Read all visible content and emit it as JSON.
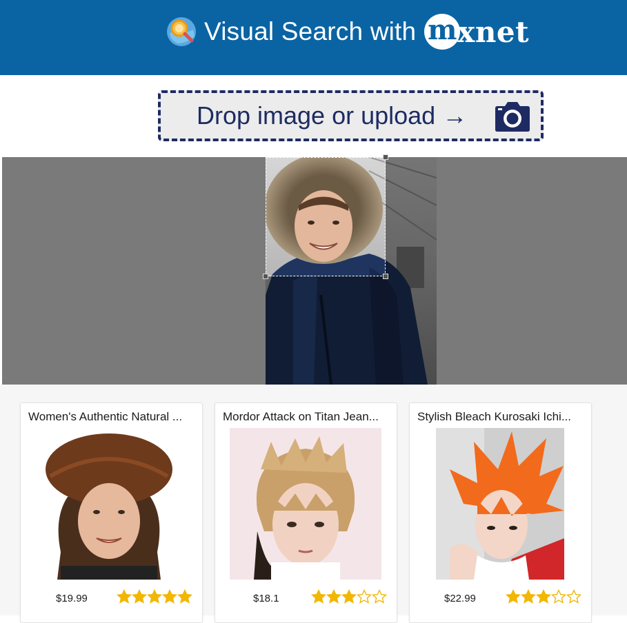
{
  "header": {
    "title": "Visual Search with",
    "brand_initial": "m",
    "brand_rest": "xnet",
    "icon": "magnifier-globe-icon",
    "bg_color": "#0a64a4"
  },
  "upload": {
    "label": "Drop image or upload →",
    "icon": "camera-icon",
    "accent": "#1e2b63"
  },
  "viewer": {
    "image": "query-photo-man-in-fur-hood-parka",
    "crop": "selection-box-with-handles"
  },
  "results": [
    {
      "title": "Women's Authentic Natural ...",
      "price": "$19.99",
      "rating": 5,
      "image": "woman-in-brown-fur-hat"
    },
    {
      "title": "Mordor Attack on Titan Jean...",
      "price": "$18.1",
      "rating": 3,
      "image": "person-in-blonde-spiky-wig"
    },
    {
      "title": "Stylish Bleach Kurosaki Ichi...",
      "price": "$22.99",
      "rating": 3,
      "image": "person-in-orange-spiky-wig"
    }
  ],
  "colors": {
    "star": "#f2b705",
    "viewer_bg": "#7a7a7a"
  }
}
